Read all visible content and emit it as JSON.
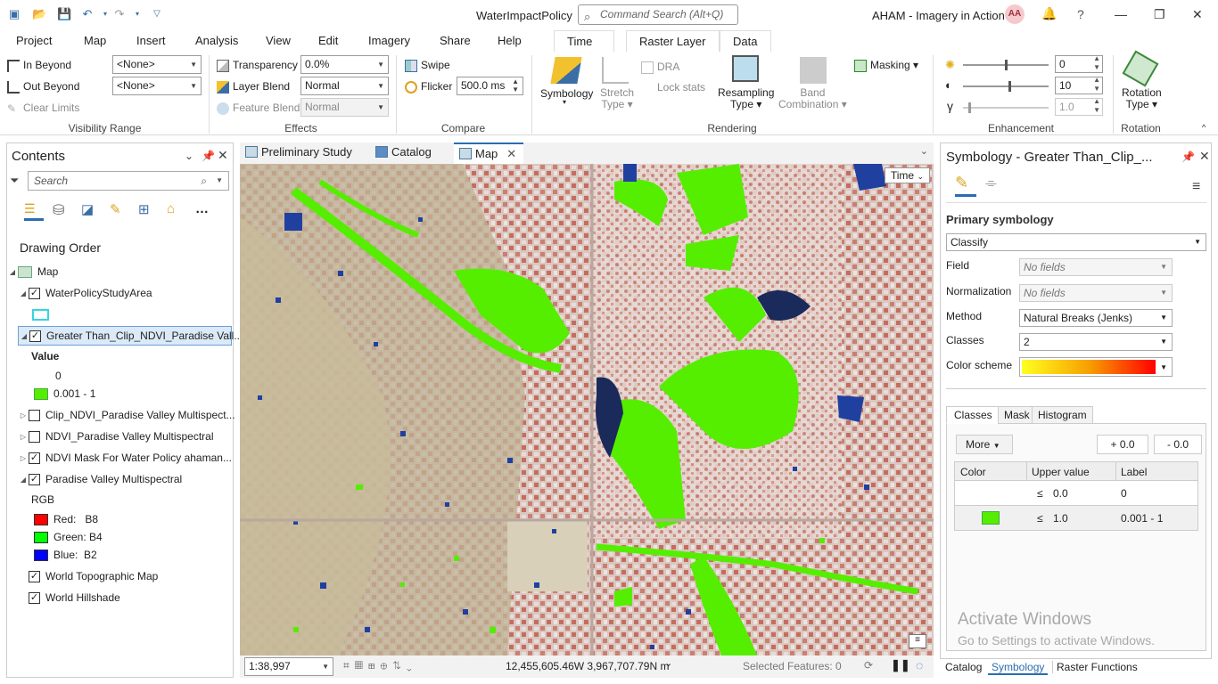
{
  "title_bar": {
    "app_title": "WaterImpactPolicy",
    "search_placeholder": "Command Search (Alt+Q)",
    "user_name": "AHAM - Imagery in Action",
    "avatar_initials": "AA"
  },
  "menu_tabs": [
    "Project",
    "Map",
    "Insert",
    "Analysis",
    "View",
    "Edit",
    "Imagery",
    "Share",
    "Help"
  ],
  "context_tabs": [
    "Time",
    "Raster Layer",
    "Data"
  ],
  "ribbon": {
    "visibility_range": {
      "label": "Visibility Range",
      "in_beyond": "In Beyond",
      "out_beyond": "Out Beyond",
      "clear_limits": "Clear Limits",
      "in_value": "<None>",
      "out_value": "<None>"
    },
    "effects": {
      "label": "Effects",
      "transparency": "Transparency",
      "transparency_value": "0.0%",
      "layer_blend": "Layer Blend",
      "layer_blend_value": "Normal",
      "feature_blend": "Feature Blend",
      "feature_blend_value": "Normal"
    },
    "compare": {
      "label": "Compare",
      "swipe": "Swipe",
      "flicker": "Flicker",
      "flicker_value": "500.0  ms"
    },
    "rendering": {
      "label": "Rendering",
      "symbology": "Symbology",
      "stretch_type": [
        "Stretch",
        "Type"
      ],
      "dra": "DRA",
      "lock_stats": "Lock stats",
      "resampling_type": [
        "Resampling",
        "Type"
      ],
      "band_combination": [
        "Band",
        "Combination"
      ],
      "masking": "Masking"
    },
    "enhancement": {
      "label": "Enhancement",
      "brightness": "0",
      "contrast": "10",
      "gamma": "1.0"
    },
    "rotation": {
      "label": "Rotation",
      "rotation_type": [
        "Rotation",
        "Type"
      ]
    }
  },
  "contents": {
    "title": "Contents",
    "search_placeholder": "Search",
    "drawing_order": "Drawing Order",
    "layers": [
      {
        "name": "Map",
        "type": "map"
      },
      {
        "name": "WaterPolicyStudyArea",
        "checked": true
      },
      {
        "name": "Greater Than_Clip_NDVI_Paradise Vall...",
        "checked": true,
        "selected": true,
        "legend_header": "Value",
        "legend": [
          {
            "label": "0",
            "color": ""
          },
          {
            "label": "0.001 - 1",
            "color": "#55ee00"
          }
        ]
      },
      {
        "name": "Clip_NDVI_Paradise Valley Multispect...",
        "checked": false
      },
      {
        "name": "NDVI_Paradise Valley Multispectral",
        "checked": false
      },
      {
        "name": "NDVI Mask For Water Policy ahaman...",
        "checked": true
      },
      {
        "name": "Paradise Valley Multispectral",
        "checked": true,
        "legend_header": "RGB",
        "legend": [
          {
            "label": "Red:   B8",
            "color": "#ff0000"
          },
          {
            "label": "Green: B4",
            "color": "#00ff00"
          },
          {
            "label": "Blue:  B2",
            "color": "#0000ff"
          }
        ]
      },
      {
        "name": "World Topographic Map",
        "checked": true
      },
      {
        "name": "World Hillshade",
        "checked": true
      }
    ]
  },
  "view_tabs": [
    "Preliminary Study",
    "Catalog",
    "Map"
  ],
  "map": {
    "time_button": "Time"
  },
  "status_bar": {
    "scale": "1:38,997",
    "coordinates": "12,455,605.46W 3,967,707.79N m",
    "selected_features": "Selected Features: 0"
  },
  "symbology_pane": {
    "title": "Symbology - Greater Than_Clip_...",
    "primary": "Primary symbology",
    "renderer": "Classify",
    "field_label": "Field",
    "field_value": "No fields",
    "normalization_label": "Normalization",
    "normalization_value": "No fields",
    "method_label": "Method",
    "method_value": "Natural Breaks (Jenks)",
    "classes_label": "Classes",
    "classes_value": "2",
    "color_scheme_label": "Color scheme",
    "tabs": [
      "Classes",
      "Mask",
      "Histogram"
    ],
    "more": "More",
    "plus": "+ 0.0",
    "minus": "- 0.0",
    "table_headers": [
      "Color",
      "Upper value",
      "Label"
    ],
    "rows": [
      {
        "color": "",
        "op": "≤",
        "upper": "0.0",
        "label": "0"
      },
      {
        "color": "#55ee00",
        "op": "≤",
        "upper": "1.0",
        "label": "0.001 - 1"
      }
    ],
    "watermark_title": "Activate Windows",
    "watermark_sub": "Go to Settings to activate Windows."
  },
  "bottom_tabs": [
    "Catalog",
    "Symbology",
    "Raster Functions"
  ],
  "colors": {
    "accent": "#2b6cb0",
    "ndvi_green": "#55ee00",
    "water_blue": "#2040a0"
  }
}
